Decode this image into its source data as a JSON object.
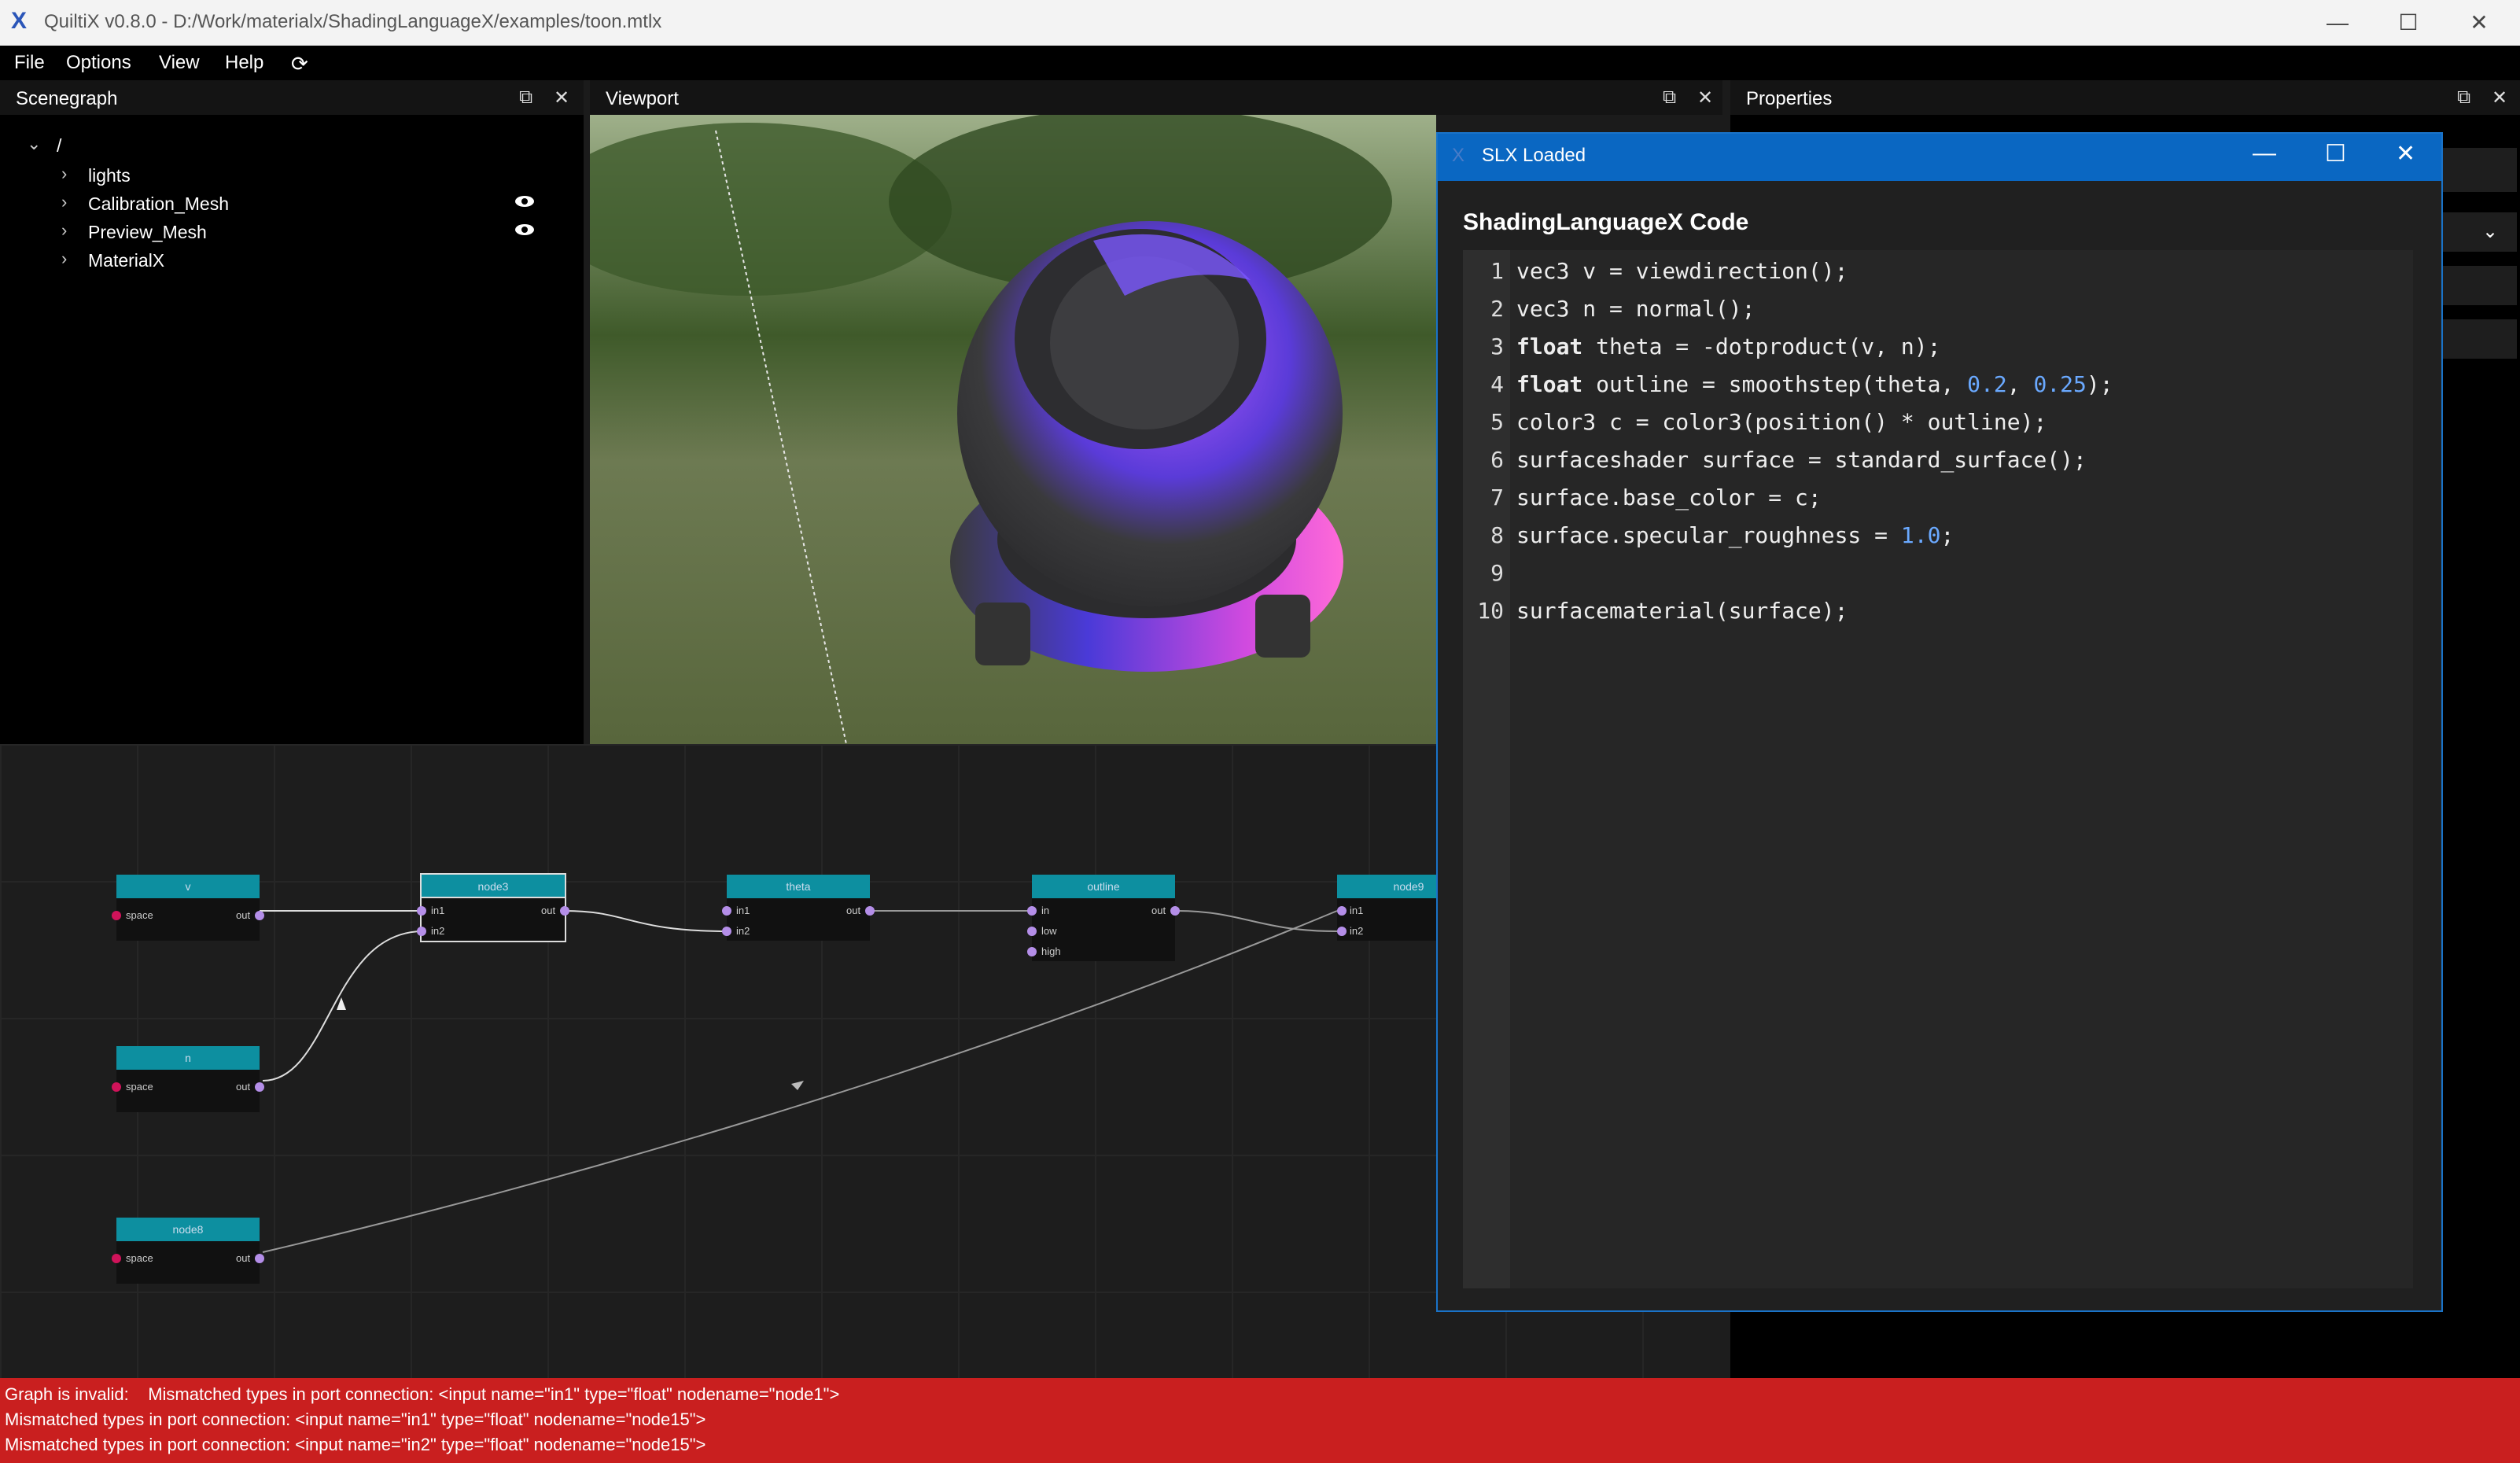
{
  "window": {
    "title": "QuiltiX v0.8.0 - D:/Work/materialx/ShadingLanguageX/examples/toon.mtlx",
    "minimize": "—",
    "maximize": "☐",
    "close": "✕"
  },
  "menu": [
    "File",
    "Options",
    "View",
    "Help"
  ],
  "panels": {
    "scenegraph": "Scenegraph",
    "viewport": "Viewport",
    "properties": "Properties"
  },
  "scenegraph": {
    "root": "/",
    "items": [
      "lights",
      "Calibration_Mesh",
      "Preview_Mesh",
      "MaterialX"
    ]
  },
  "nodes": [
    {
      "title": "v",
      "inputs": [
        "space"
      ],
      "output": "out"
    },
    {
      "title": "node3",
      "inputs": [
        "in1",
        "in2"
      ],
      "output": "out"
    },
    {
      "title": "theta",
      "inputs": [
        "in1",
        "in2"
      ],
      "output": "out"
    },
    {
      "title": "outline",
      "inputs": [
        "in",
        "low",
        "high"
      ],
      "output": "out"
    },
    {
      "title": "node9",
      "inputs": [
        "in1",
        "in2"
      ],
      "output": ""
    },
    {
      "title": "n",
      "inputs": [
        "space"
      ],
      "output": "out"
    },
    {
      "title": "node8",
      "inputs": [
        "space"
      ],
      "output": "out"
    }
  ],
  "dialog": {
    "title": "SLX Loaded",
    "heading": "ShadingLanguageX Code",
    "lines": [
      {
        "n": "1",
        "text": "vec3 v = viewdirection();"
      },
      {
        "n": "2",
        "text": "vec3 n = normal();"
      },
      {
        "n": "3",
        "kw": "float",
        "text": " theta = -dotproduct(v, n);"
      },
      {
        "n": "4",
        "kw": "float",
        "pre": " outline = smoothstep(theta, ",
        "a": "0.2",
        "mid": ", ",
        "b": "0.25",
        "post": ");"
      },
      {
        "n": "5",
        "text": "color3 c = color3(position() * outline);"
      },
      {
        "n": "6",
        "text": "surfaceshader surface = standard_surface();"
      },
      {
        "n": "7",
        "text": "surface.base_color = c;"
      },
      {
        "n": "8",
        "pre": "surface.specular_roughness = ",
        "a": "1.0",
        "post": ";"
      },
      {
        "n": "9",
        "text": ""
      },
      {
        "n": "10",
        "text": "surfacematerial(surface);"
      }
    ]
  },
  "status": [
    "Graph is invalid:    Mismatched types in port connection: <input name=\"in1\" type=\"float\" nodename=\"node1\">",
    "Mismatched types in port connection: <input name=\"in1\" type=\"float\" nodename=\"node15\">",
    "Mismatched types in port connection: <input name=\"in2\" type=\"float\" nodename=\"node15\">"
  ],
  "colors": {
    "node_header": "#0d8fa0",
    "status_error": "#c91f1f",
    "dialog_titlebar": "#0a67c2",
    "port_input": "#b48ee8",
    "port_space": "#d0135a"
  }
}
